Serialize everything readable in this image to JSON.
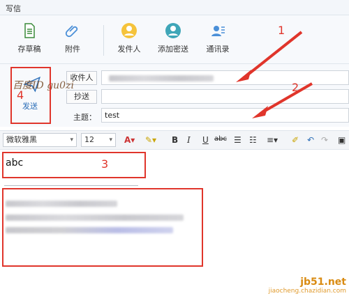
{
  "window": {
    "title": "写信"
  },
  "toolbar": {
    "draft": "存草稿",
    "attach": "附件",
    "sender": "发件人",
    "bcc": "添加密送",
    "contacts": "通讯录"
  },
  "header": {
    "send": "发送",
    "to_button": "收件人",
    "cc_button": "抄送",
    "subject_label": "主题：",
    "subject_value": "test",
    "watermark": "百度ID gu0zi"
  },
  "format": {
    "font": "微软雅黑",
    "size": "12",
    "bold": "B",
    "italic": "I",
    "underline": "U",
    "strike": "abc"
  },
  "body": {
    "text": "abc"
  },
  "annotations": {
    "n1": "1",
    "n2": "2",
    "n3": "3",
    "n4": "4"
  },
  "site": {
    "line1": "jb51.net",
    "line2": "jiaocheng.chazidian.com"
  },
  "colors": {
    "accent": "#e0352b",
    "link": "#2a6db7"
  }
}
